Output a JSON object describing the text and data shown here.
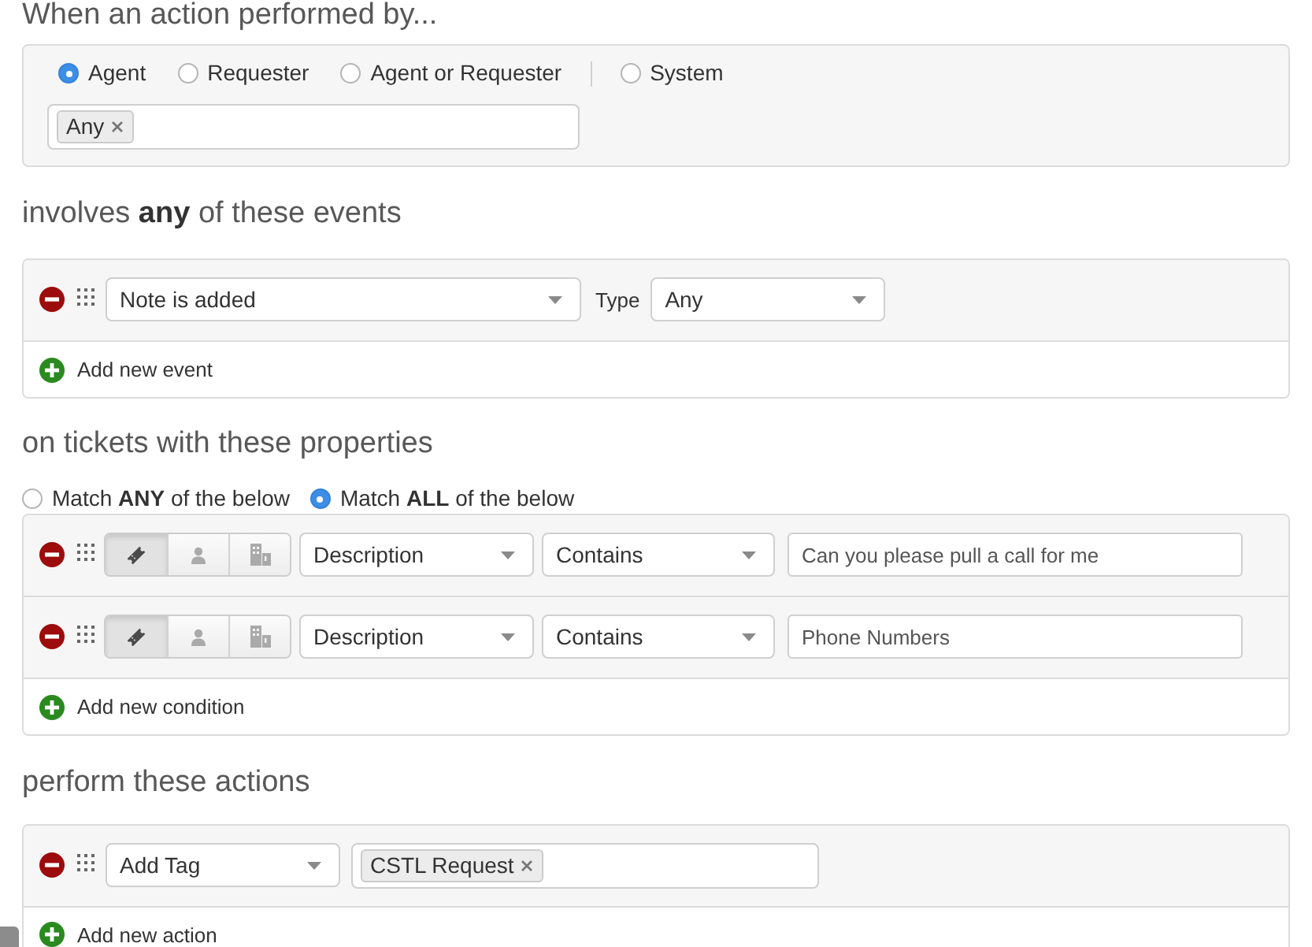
{
  "performer": {
    "heading": "When an action performed by...",
    "option_groups": [
      {
        "options": [
          {
            "label": "Agent",
            "selected": true
          },
          {
            "label": "Requester",
            "selected": false
          },
          {
            "label": "Agent or Requester",
            "selected": false
          }
        ]
      },
      {
        "options": [
          {
            "label": "System",
            "selected": false
          }
        ]
      }
    ],
    "tags": [
      {
        "label": "Any"
      }
    ]
  },
  "events": {
    "heading": "involves **any** of these events",
    "rows": [
      {
        "event": "Note is added",
        "type_label": "Type",
        "type": "Any"
      }
    ],
    "add_label": "Add new event"
  },
  "conditions": {
    "heading": "on tickets with these properties",
    "match": [
      {
        "label": "Match **ANY** of the below",
        "selected": false
      },
      {
        "label": "Match **ALL** of the below",
        "selected": true
      }
    ],
    "rows": [
      {
        "scopes": [
          {
            "kind": "ticket",
            "selected": true
          },
          {
            "kind": "requester",
            "selected": false
          },
          {
            "kind": "company",
            "selected": false
          }
        ],
        "field": "Description",
        "operator": "Contains",
        "value": "Can you please pull a call for me"
      },
      {
        "scopes": [
          {
            "kind": "ticket",
            "selected": true
          },
          {
            "kind": "requester",
            "selected": false
          },
          {
            "kind": "company",
            "selected": false
          }
        ],
        "field": "Description",
        "operator": "Contains",
        "value": "Phone Numbers"
      }
    ],
    "add_label": "Add new condition"
  },
  "actions": {
    "heading": "perform these actions",
    "rows": [
      {
        "action": "Add Tag",
        "tags": [
          {
            "label": "CSTL Request"
          }
        ]
      }
    ],
    "add_label": "Add new action"
  }
}
